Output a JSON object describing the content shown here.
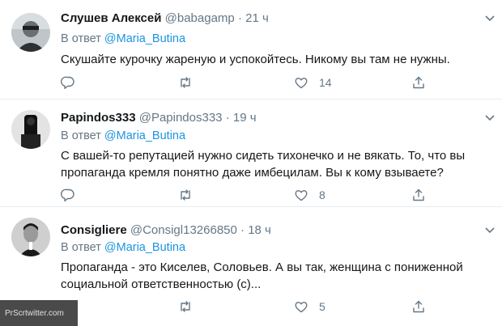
{
  "tweets": [
    {
      "name": "Слушев Алексей",
      "handle": "@babagamp",
      "dot": "·",
      "time": "21 ч",
      "reply_prefix": "В ответ",
      "reply_mention": "@Maria_Butina",
      "text_lines": [
        "Скушайте курочку жареную и успокойтесь. Никому вы там не нужны."
      ],
      "likes": "14"
    },
    {
      "name": "Papindos333",
      "handle": "@Papindos333",
      "dot": "·",
      "time": "19 ч",
      "reply_prefix": "В ответ",
      "reply_mention": "@Maria_Butina",
      "text_lines": [
        "С вашей-то репутацией нужно сидеть тихонечко и не вякать. То, что вы",
        "пропаганда кремля понятно даже имбецилам. Вы к кому взываете?"
      ],
      "likes": "8"
    },
    {
      "name": "Consigliere",
      "handle": "@Consigl13266850",
      "dot": "·",
      "time": "18 ч",
      "reply_prefix": "В ответ",
      "reply_mention": "@Maria_Butina",
      "text_lines": [
        "Пропаганда - это Киселев, Соловьев. А вы так, женщина с пониженной",
        "социальной ответственностью (с)..."
      ],
      "likes": "5"
    }
  ],
  "watermark": "PrScrtwitter.com",
  "icons": {
    "reply": "reply-icon",
    "retweet": "retweet-icon",
    "like": "like-icon",
    "share": "share-icon",
    "caret": "chevron-down-icon"
  },
  "colors": {
    "name": "#14171a",
    "muted": "#657786",
    "mention": "#1b95e0",
    "divider": "#e6ecf0"
  }
}
